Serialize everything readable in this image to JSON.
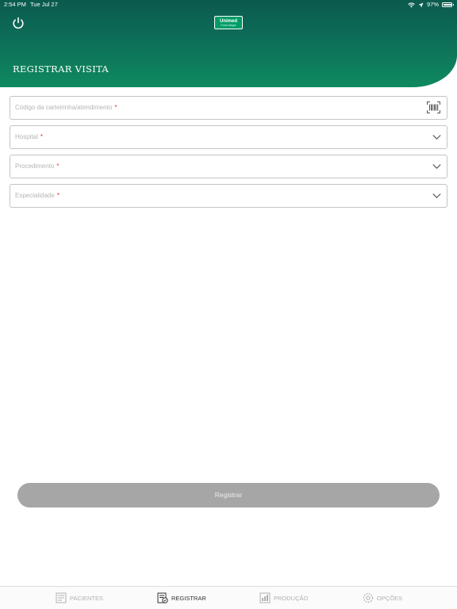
{
  "status_bar": {
    "time": "2:54 PM",
    "date": "Tue Jul 27",
    "battery": "97%"
  },
  "header": {
    "logo_text": "Unimed",
    "logo_subtext": "Porto Alegre",
    "title": "REGISTRAR VISITA",
    "gradient_top": "#0b5a4e",
    "gradient_bottom": "#0f8a5f"
  },
  "form": {
    "required_mark": "*",
    "card_code": {
      "placeholder": "Código da carteirinha/atendimento"
    },
    "hospital": {
      "placeholder": "Hospital"
    },
    "procedure": {
      "placeholder": "Procedimento"
    },
    "specialty": {
      "placeholder": "Especialidade"
    }
  },
  "actions": {
    "register_label": "Registrar"
  },
  "tabbar": {
    "items": [
      {
        "label": "PACIENTES",
        "icon": "patients-icon",
        "active": false
      },
      {
        "label": "REGISTRAR",
        "icon": "register-icon",
        "active": true
      },
      {
        "label": "PRODUÇÃO",
        "icon": "production-icon",
        "active": false
      },
      {
        "label": "OPÇÕES",
        "icon": "options-icon",
        "active": false
      }
    ]
  },
  "colors": {
    "required": "#e0352b",
    "button_disabled": "#a6a6a6",
    "tab_active": "#333333",
    "tab_inactive": "#b0b0b0"
  }
}
